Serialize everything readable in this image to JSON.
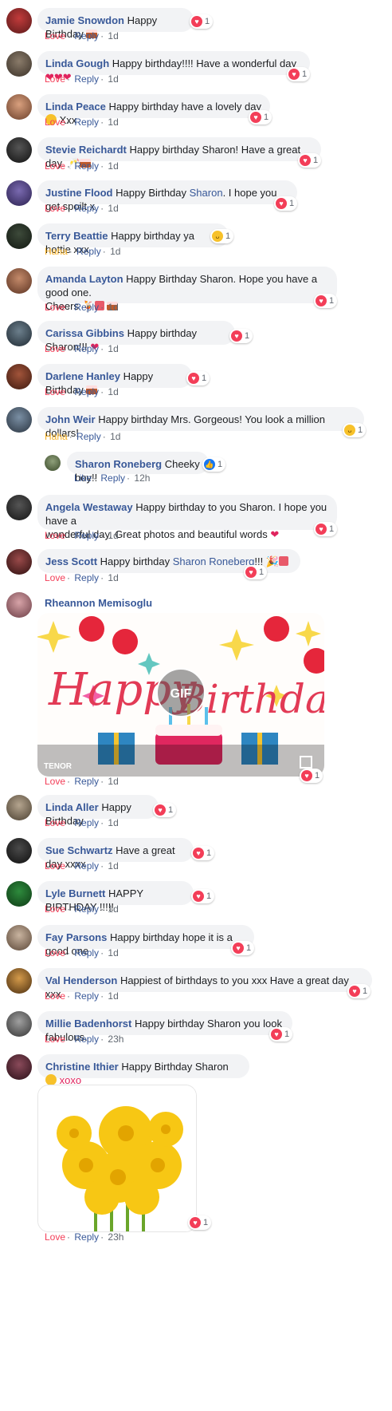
{
  "comments": [
    {
      "name": "Jamie Snowdon",
      "text": "Happy Birthday",
      "action": "Love",
      "reply": "Reply",
      "time": "1d",
      "count": "1"
    },
    {
      "name": "Linda Gough",
      "text": "Happy birthday!!!! Have a wonderful day",
      "action": "Love",
      "reply": "Reply",
      "time": "1d",
      "count": "1"
    },
    {
      "name": "Linda Peace",
      "text": "Happy birthday have a lovely day",
      "text2": "Xxx",
      "action": "Love",
      "reply": "Reply",
      "time": "1d",
      "count": "1"
    },
    {
      "name": "Stevie Reichardt",
      "text": "Happy birthday Sharon! Have a great day.",
      "action": "Love",
      "reply": "Reply",
      "time": "1d",
      "count": "1"
    },
    {
      "name": "Justine Flood",
      "text": "Happy Birthday",
      "mention": "Sharon",
      "text2": ". I hope you get spoilt x",
      "action": "Love",
      "reply": "Reply",
      "time": "1d",
      "count": "1"
    },
    {
      "name": "Terry Beattie",
      "text": "Happy birthday ya hottie xxx",
      "action": "Haha",
      "reply": "Reply",
      "time": "1d",
      "count": "1"
    },
    {
      "name": "Amanda Layton",
      "text": "Happy Birthday Sharon. Hope you have a good one.",
      "text2": "Cheers",
      "action": "Love",
      "reply": "Reply",
      "time": "1d",
      "count": "1"
    },
    {
      "name": "Carissa Gibbins",
      "text": "Happy birthday Sharon!!!",
      "action": "Love",
      "reply": "Reply",
      "time": "1d",
      "count": "1"
    },
    {
      "name": "Darlene Hanley",
      "text": "Happy Birthday",
      "action": "Love",
      "reply": "Reply",
      "time": "1d",
      "count": "1"
    },
    {
      "name": "John Weir",
      "text": "Happy birthday Mrs. Gorgeous! You look a million dollars!",
      "action": "Haha",
      "reply": "Reply",
      "time": "1d",
      "count": "1"
    },
    {
      "name": "Sharon Roneberg",
      "text": "Cheeky boy!!",
      "action": "Like",
      "reply": "Reply",
      "time": "12h",
      "count": "1"
    },
    {
      "name": "Angela Westaway",
      "text": "Happy birthday to you Sharon. I hope you have a",
      "text2": "wonderful day. Great photos and beautiful words",
      "action": "Love",
      "reply": "Reply",
      "time": "1d",
      "count": "1"
    },
    {
      "name": "Jess Scott",
      "text": "Happy birthday",
      "mention": "Sharon Roneberg",
      "text2": "!!!",
      "action": "Love",
      "reply": "Reply",
      "time": "1d",
      "count": "1"
    },
    {
      "name": "Rheannon Memisoglu",
      "gif_label": "GIF",
      "tenor": "TENOR",
      "gif_word1": "Happy",
      "gif_word2": "Birthday",
      "action": "Love",
      "reply": "Reply",
      "time": "1d",
      "count": "1"
    },
    {
      "name": "Linda Aller",
      "text": "Happy Birthday",
      "action": "Love",
      "reply": "Reply",
      "time": "1d",
      "count": "1"
    },
    {
      "name": "Sue Schwartz",
      "text": "Have a great day xxxx",
      "action": "Love",
      "reply": "Reply",
      "time": "1d",
      "count": "1"
    },
    {
      "name": "Lyle Burnett",
      "text": "HAPPY BIRTHDAY !!!!!",
      "action": "Love",
      "reply": "Reply",
      "time": "1d",
      "count": "1"
    },
    {
      "name": "Fay Parsons",
      "text": "Happy birthday hope it is a good one",
      "action": "Love",
      "reply": "Reply",
      "time": "1d",
      "count": "1"
    },
    {
      "name": "Val Henderson",
      "text": "Happiest of birthdays to you xxx Have a great day xxx",
      "action": "Love",
      "reply": "Reply",
      "time": "1d",
      "count": "1"
    },
    {
      "name": "Millie Badenhorst",
      "text": "Happy birthday Sharon you look fabulous.",
      "action": "Love",
      "reply": "Reply",
      "time": "23h",
      "count": "1"
    },
    {
      "name": "Christine Ithier",
      "text": "Happy Birthday Sharon",
      "text2": "xoxo",
      "action": "Love",
      "reply": "Reply",
      "time": "23h",
      "count": "1"
    }
  ],
  "colors": {
    "name": "#385898",
    "love": "#f33e58",
    "haha": "#f7b125",
    "bubble": "#f2f3f5"
  }
}
